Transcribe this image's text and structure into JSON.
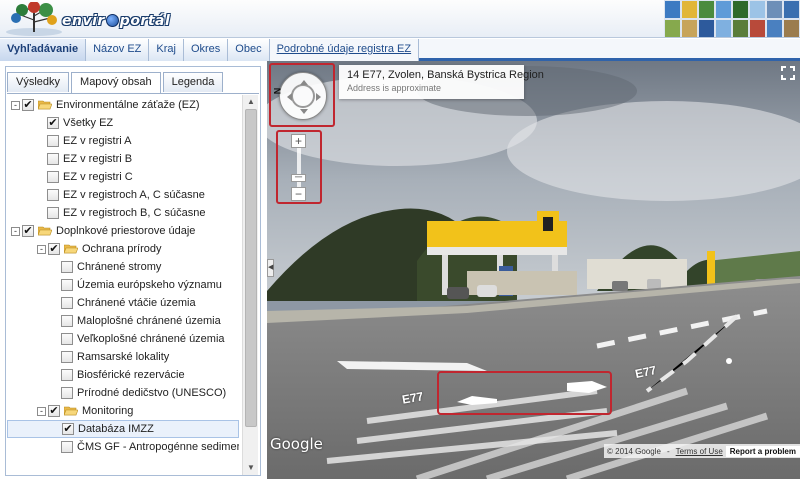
{
  "header": {
    "logo_left": "envir",
    "logo_right": "portál"
  },
  "nav": {
    "tabs": [
      {
        "label": "Vyhľadávanie"
      },
      {
        "label": "Názov EZ"
      },
      {
        "label": "Kraj"
      },
      {
        "label": "Okres"
      },
      {
        "label": "Obec"
      },
      {
        "label": "Podrobné údaje registra EZ"
      }
    ]
  },
  "panel": {
    "tabs": [
      {
        "label": "Výsledky"
      },
      {
        "label": "Mapový obsah"
      },
      {
        "label": "Legenda"
      }
    ],
    "tree": [
      {
        "label": "Environmentálne záťaže (EZ)",
        "level": 0,
        "expander": "-",
        "checked": true,
        "folder": true
      },
      {
        "label": "Všetky EZ",
        "level": 1,
        "checked": true
      },
      {
        "label": "EZ v registri A",
        "level": 1,
        "checked": false
      },
      {
        "label": "EZ v registri B",
        "level": 1,
        "checked": false
      },
      {
        "label": "EZ v registri C",
        "level": 1,
        "checked": false
      },
      {
        "label": "EZ v registroch A, C súčasne",
        "level": 1,
        "checked": false
      },
      {
        "label": "EZ v registroch B, C súčasne",
        "level": 1,
        "checked": false
      },
      {
        "label": "Doplnkové priestorove údaje",
        "level": 0,
        "expander": "-",
        "checked": true,
        "folder": true
      },
      {
        "label": "Ochrana prírody",
        "level": 1,
        "expander": "-",
        "checked": true,
        "folder": true
      },
      {
        "label": "Chránené stromy",
        "level": 2,
        "checked": false
      },
      {
        "label": "Územia európskeho významu",
        "level": 2,
        "checked": false
      },
      {
        "label": "Chránené vtáčie územia",
        "level": 2,
        "checked": false
      },
      {
        "label": "Maloplošné chránené územia",
        "level": 2,
        "checked": false
      },
      {
        "label": "Veľkoplošné chránené územia",
        "level": 2,
        "checked": false
      },
      {
        "label": "Ramsarské lokality",
        "level": 2,
        "checked": false
      },
      {
        "label": "Biosférické rezervácie",
        "level": 2,
        "checked": false
      },
      {
        "label": "Prírodné dedičstvo (UNESCO)",
        "level": 2,
        "checked": false
      },
      {
        "label": "Monitoring",
        "level": 1,
        "expander": "-",
        "checked": true,
        "folder": true
      },
      {
        "label": "Databáza IMZZ",
        "level": 2,
        "checked": true,
        "selected": true
      },
      {
        "label": "ČMS GF - Antropogénne sedimenty",
        "level": 2,
        "checked": false
      }
    ]
  },
  "streetview": {
    "title": "14 E77, Zvolen, Banská Bystrica Region",
    "subtitle": "Address is approximate",
    "compass_label": "N",
    "zoom_in": "+",
    "zoom_out": "−",
    "road_label_left": "E77",
    "road_label_right": "E77",
    "brand": "Google",
    "copyright": "© 2014 Google",
    "terms": "Terms of Use",
    "report": "Report a problem"
  }
}
